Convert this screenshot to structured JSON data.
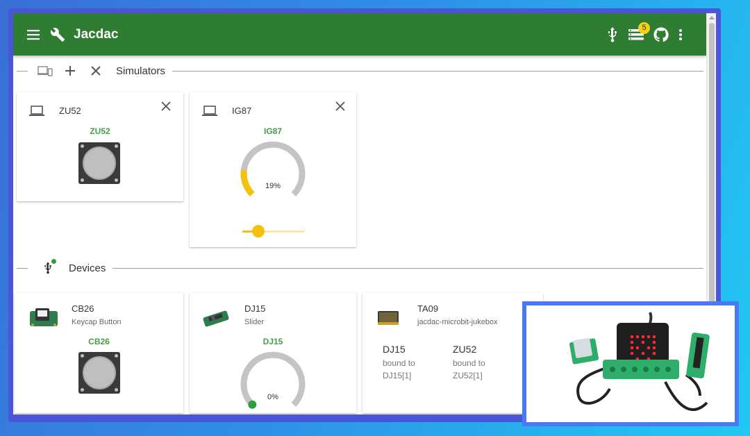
{
  "app": {
    "title": "Jacdac",
    "notification_count": "5"
  },
  "simulators_section": {
    "label": "Simulators"
  },
  "devices_section": {
    "label": "Devices"
  },
  "simulators": [
    {
      "id": "ZU52",
      "name": "ZU52",
      "widget": "button"
    },
    {
      "id": "IG87",
      "name": "IG87",
      "widget": "slider-gauge",
      "value_label": "19%",
      "value": 0.19
    }
  ],
  "devices": [
    {
      "id": "CB26",
      "subtitle": "Keycap Button",
      "name": "CB26",
      "widget": "button"
    },
    {
      "id": "DJ15",
      "subtitle": "Slider",
      "name": "DJ15",
      "widget": "gauge",
      "value_label": "0%",
      "value": 0.0
    },
    {
      "id": "TA09",
      "subtitle": "jacdac-microbit-jukebox",
      "bindings": [
        {
          "name": "DJ15",
          "line1": "bound to",
          "line2": "DJ15[1]"
        },
        {
          "name": "ZU52",
          "line1": "bound to",
          "line2": "ZU52[1]"
        }
      ]
    }
  ],
  "colors": {
    "appbar": "#2e7d32",
    "accent": "#f4c20d",
    "name_green": "#43a047",
    "gauge_track": "#c4c4c4"
  },
  "icons": {
    "menu": "menu-icon",
    "wrench": "wrench-icon",
    "usb": "usb-icon",
    "list": "list-icon",
    "github": "github-icon",
    "more": "more-vert-icon",
    "devices": "devices-icon",
    "add": "add-icon",
    "close": "close-icon",
    "laptop": "laptop-icon"
  }
}
